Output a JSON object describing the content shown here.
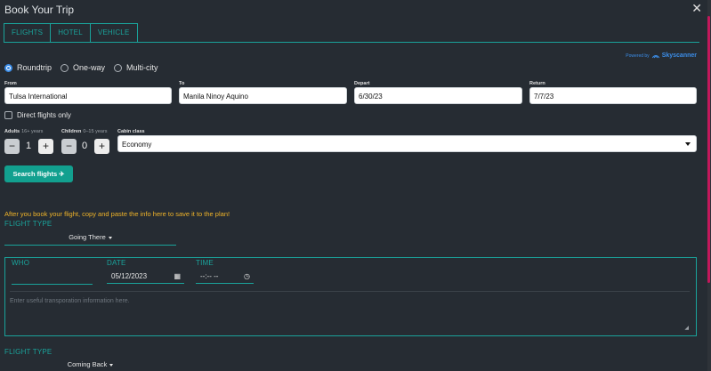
{
  "window": {
    "title": "Book Your Trip",
    "close_glyph": "✕"
  },
  "tabs": [
    {
      "label": "FLIGHTS"
    },
    {
      "label": "HOTEL"
    },
    {
      "label": "VEHICLE"
    }
  ],
  "powered": {
    "text": "Powered by",
    "brand": "Skyscanner"
  },
  "trip_type": {
    "selected": "Roundtrip",
    "options": [
      "Roundtrip",
      "One-way",
      "Multi-city"
    ]
  },
  "search": {
    "from_label": "From",
    "from_value": "Tulsa International",
    "to_label": "To",
    "to_value": "Manila Ninoy Aquino",
    "depart_label": "Depart",
    "depart_value": "6/30/23",
    "return_label": "Return",
    "return_value": "7/7/23",
    "direct_label": "Direct flights only",
    "adults_label": "Adults",
    "adults_sub": "16+ years",
    "adults_value": "1",
    "children_label": "Children",
    "children_sub": "0–15 years",
    "children_value": "0",
    "cabin_label": "Cabin class",
    "cabin_value": "Economy",
    "button_label": "Search flights ✈"
  },
  "note": "After you book your flight, copy and paste the info here to save it to the plan!",
  "flight_type_label": "FLIGHT TYPE",
  "going": {
    "dropdown": "Going There",
    "who_label": "WHO",
    "who_value": "",
    "date_label": "DATE",
    "date_value": "05/12/2023",
    "time_label": "TIME",
    "time_value": "--:-- --",
    "textarea_placeholder": "Enter useful transporation information here."
  },
  "coming": {
    "dropdown": "Coming Back"
  },
  "colors": {
    "accent": "#1aa39b",
    "search_button": "#12a08f",
    "note": "#f0b429",
    "background": "#262c33",
    "brand": "#3b8de8",
    "scroll_thumb": "#c2185b"
  }
}
